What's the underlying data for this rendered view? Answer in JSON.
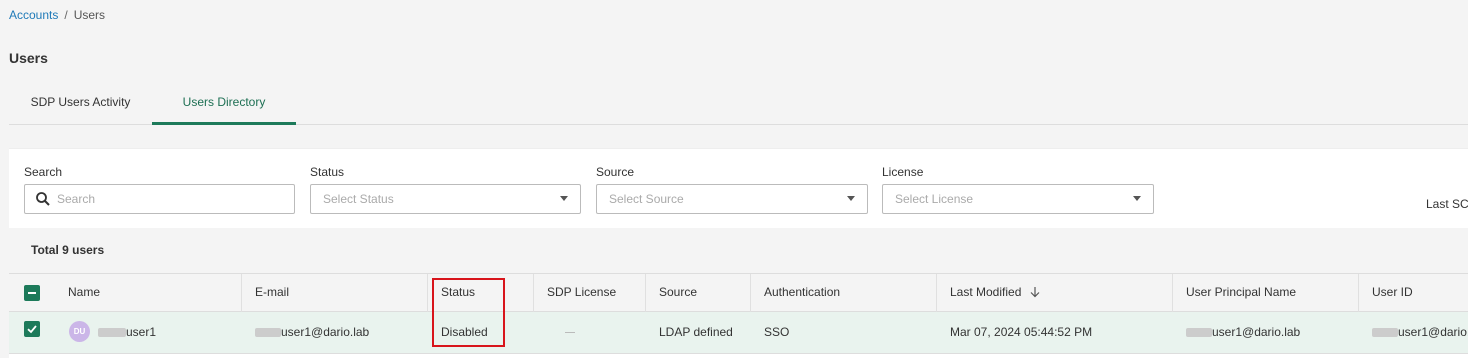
{
  "breadcrumb": {
    "parent": "Accounts",
    "separator": "/",
    "current": "Users"
  },
  "page_title": "Users",
  "tabs": [
    {
      "label": "SDP Users Activity",
      "active": false
    },
    {
      "label": "Users Directory",
      "active": true
    }
  ],
  "filters": {
    "search": {
      "label": "Search",
      "placeholder": "Search"
    },
    "status": {
      "label": "Status",
      "placeholder": "Select Status"
    },
    "source": {
      "label": "Source",
      "placeholder": "Select Source"
    },
    "license": {
      "label": "License",
      "placeholder": "Select License"
    },
    "last_sc_label": "Last SC"
  },
  "summary": {
    "total_label": "Total 9 users"
  },
  "table": {
    "columns": [
      "Name",
      "E-mail",
      "Status",
      "SDP License",
      "Source",
      "Authentication",
      "Last Modified",
      "User Principal Name",
      "User ID"
    ],
    "sort_column": "Last Modified",
    "sort_direction": "descending",
    "rows": [
      {
        "selected": true,
        "avatar": "DU",
        "name": "user1",
        "email": "user1@dario.lab",
        "status": "Disabled",
        "sdp_license": "",
        "source": "LDAP defined",
        "authentication": "SSO",
        "last_modified": "Mar 07, 2024 05:44:52 PM",
        "upn": "user1@dario.lab",
        "user_id": "user1@dario."
      }
    ]
  },
  "colors": {
    "accent_green": "#1d7a5a",
    "link_blue": "#1f7ab8",
    "highlight_red": "#d8141b",
    "selected_row": "#e9f3ee",
    "avatar_bg": "#cbb6e8"
  }
}
